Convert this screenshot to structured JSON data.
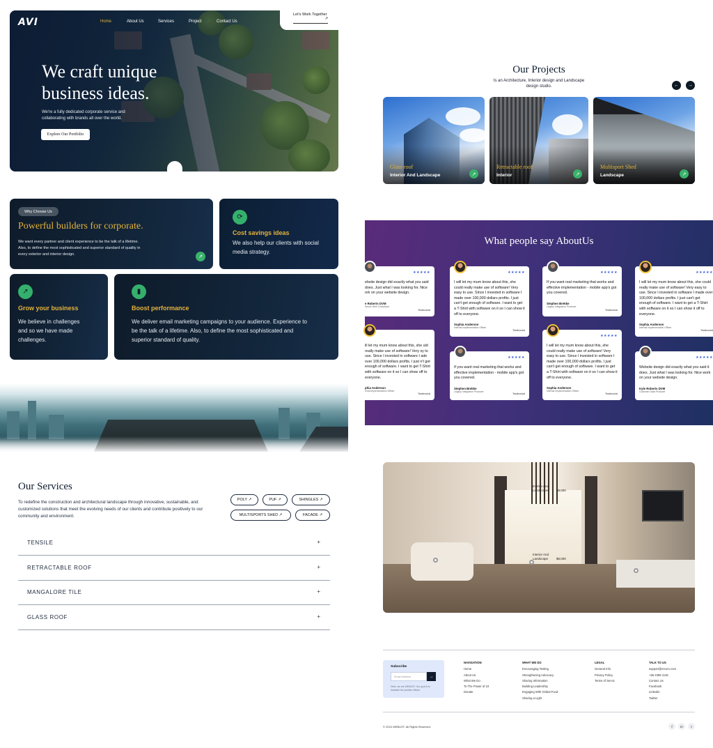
{
  "header": {
    "logo": "AVI",
    "nav": [
      "Home",
      "About Us",
      "Services",
      "Project",
      "Contact Us"
    ],
    "cta": "Let's Work Together"
  },
  "hero": {
    "title": "We craft unique business ideas.",
    "subtitle": "We're a fully dedicated corporate service and collaborating with brands all over the world.",
    "button": "Explore Our Portfolio"
  },
  "projects": {
    "title": "Our Projects",
    "subtitle": "Is an Architecture, Interior design and Landscape design studio.",
    "items": [
      {
        "title": "Glass roof",
        "category": "Interior And Landscape"
      },
      {
        "title": "Retractable roof",
        "category": "Interior"
      },
      {
        "title": "Multisport Shed",
        "category": "Landscape"
      }
    ]
  },
  "why": {
    "pill": "Why Choose Us",
    "title": "Powerful builders for corporate.",
    "text": "We want every partner and client experience to be the talk of a lifetime. Also, to define the most sophisticated and superior standard of quality in every exterior and interior design."
  },
  "features": [
    {
      "title": "Cost savings ideas",
      "text": "We also help our clients with social media strategy."
    },
    {
      "title": "Grow your business",
      "text": "We believe in challenges and so we have made challenges."
    },
    {
      "title": "Boost performance",
      "text": "We deliver email marketing campaigns to your audience. Experience to be the talk of a lifetime. Also, to define the most sophisticated and superior standard of quality."
    }
  ],
  "testimonials": {
    "title": "What people say AboutUs",
    "stars": "★★★★★",
    "badge": "Testimonial",
    "cards": [
      {
        "quote": "ebsite design did exactly what you said does. Just what I was looking for. Nice ork on your website design.",
        "name": "e Roberts DVM",
        "role": "Senior Web Consultant"
      },
      {
        "quote": "I will let my mum know about this, she could really make use of software! Very easy to use. Since I invested in software I made over 100,000 dollars profits. I just can't get enough of software. I want to get a T-Shirt with software on it so I can show it off to everyone.",
        "name": "Sophia Anderson",
        "role": "Internal Implementation Officer"
      },
      {
        "quote": "If you want real marketing that works and effective implementation - mobile app's got you covered.",
        "name": "Stephen Brekke",
        "role": "Legacy Integration Producer"
      },
      {
        "quote": "I will let my mum know about this, she could really make use of software! Very easy to use. Since I invested in software I made over 100,000 dollars profits. I just can't get enough of software. I want to get a T-Shirt with software on it so I can show it off to everyone.",
        "name": "Sophia Anderson",
        "role": "Internal Implementation Officer"
      },
      {
        "quote": "ill let my mum know about this, she uld really make use of software! Very sy to use. Since I invested in software I ade over 100,000 dollars profits. I just n't get enough of software. I want to get T-Shirt with software on it so I can show off to everyone.",
        "name": "phia Anderson",
        "role": "ernal Implementation Officer"
      },
      {
        "quote": "If you want real marketing that works and effective implementation - mobile app's got you covered.",
        "name": "Stephen Brekke",
        "role": "Legacy Integration Producer"
      },
      {
        "quote": "I will let my mum know about this, she could really make use of software! Very easy to use. Since I invested in software I made over 100,000 dollars profits. I just can't get enough of software. I want to get a T-Shirt with software on it so I can show it off to everyone.",
        "name": "Sophia Anderson",
        "role": "Internal Implementation Officer"
      },
      {
        "quote": "Website design did exactly what you said it does. Just what I was looking for. Nice work on your website design.",
        "name": "Kyle Roberts DVM",
        "role": "Customer Data Producer"
      }
    ]
  },
  "services": {
    "title": "Our Services",
    "text": "To redefine the construction and architectural landscape through innovative, sustainable, and customized solutions that meet the evolving needs of our clients and contribute positively to our community and environment.",
    "chips": [
      "POLY",
      "PUF",
      "SHINGLES",
      "MULTISPORTS SHED",
      "FACADE"
    ],
    "items": [
      "TENSILE",
      "RETRACTABLE ROOF",
      "MANGALORE TILE",
      "GLASS ROOF"
    ],
    "plus": "+"
  },
  "room": {
    "tags": [
      {
        "label": "Interior And Landscape",
        "price": "$9,000"
      },
      {
        "label": "Interior And Landscape",
        "price": "$9,000"
      }
    ]
  },
  "footer": {
    "subscribe_title": "Subscribe",
    "email_placeholder": "Email address",
    "subscribe_note": "Hello, we are WEBUST. Our goal is to translate the positive effects",
    "columns": [
      {
        "title": "NAVIGATION",
        "links": [
          "Home",
          "About Us",
          "What We Do",
          "To The Power of 10",
          "Donate"
        ]
      },
      {
        "title": "WHAT WE DO",
        "links": [
          "Encouraging Testing",
          "Strengthening Advocacy",
          "Sharing Information",
          "Building Leadership",
          "Engaging With Global Fund",
          "Sharing a Light"
        ]
      },
      {
        "title": "LEGAL",
        "links": [
          "General Info",
          "Privacy Policy",
          "Terms of Servic"
        ]
      },
      {
        "title": "TALK TO US",
        "links": [
          "support@ercom.com",
          "+66 2399 1145",
          "Contact Us",
          "Facebook",
          "Linkedin",
          "Twitter"
        ]
      }
    ],
    "copyright": "© 2024 WEBUST. All Rights Reserved.",
    "social": [
      "f",
      "in",
      "t"
    ]
  },
  "colors": {
    "accent": "#e5b33b",
    "green": "#3ab26b",
    "navy": "#0e1b2a",
    "purple": "#5a2b7a"
  }
}
